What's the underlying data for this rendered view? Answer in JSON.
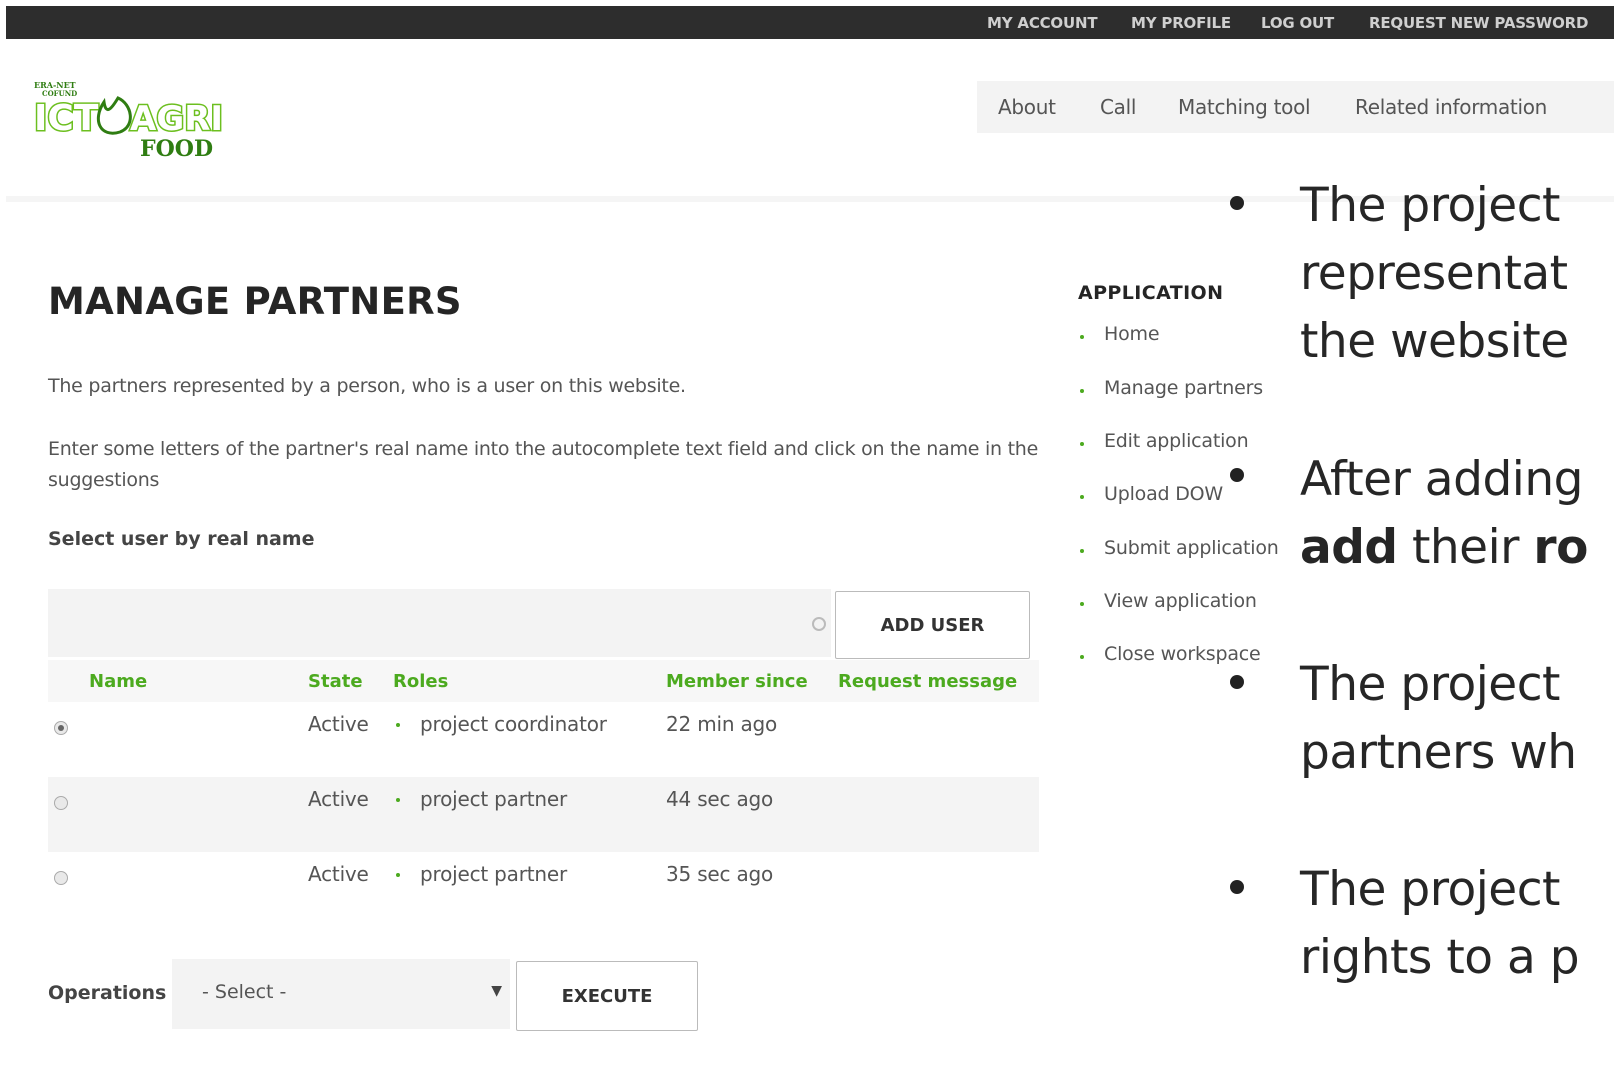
{
  "topbar": {
    "items": [
      "MY ACCOUNT",
      "MY PROFILE",
      "LOG OUT",
      "REQUEST NEW PASSWORD"
    ]
  },
  "logo": {
    "line1": "ERA-NET",
    "line2": "COFUND",
    "main": "ICT AGRI",
    "sub": "FOOD"
  },
  "mainnav": {
    "items": [
      "About",
      "Call",
      "Matching tool",
      "Related information"
    ]
  },
  "page": {
    "title": "MANAGE PARTNERS",
    "intro": "The partners represented by a person, who is a user on this website.",
    "instructions": "Enter some letters of the partner's real name into the autocomplete text field and click on the name in the suggestions",
    "select_label": "Select user by real name",
    "autocomplete_value": "",
    "add_user_label": "ADD USER"
  },
  "table": {
    "headers": {
      "name": "Name",
      "state": "State",
      "roles": "Roles",
      "member_since": "Member since",
      "request_message": "Request message"
    },
    "rows": [
      {
        "selected": true,
        "name": "",
        "state": "Active",
        "role": "project coordinator",
        "member_since": "22 min ago",
        "request_message": ""
      },
      {
        "selected": false,
        "name": "",
        "state": "Active",
        "role": "project partner",
        "member_since": "44 sec ago",
        "request_message": ""
      },
      {
        "selected": false,
        "name": "",
        "state": "Active",
        "role": "project partner",
        "member_since": "35 sec ago",
        "request_message": ""
      }
    ]
  },
  "operations": {
    "label": "Operations",
    "select_value": "- Select -",
    "execute_label": "EXECUTE"
  },
  "sidebar": {
    "title": "APPLICATION",
    "items": [
      "Home",
      "Manage partners",
      "Edit application",
      "Upload DOW",
      "Submit application",
      "View application",
      "Close workspace"
    ]
  },
  "slide": {
    "b1_l1": "The project",
    "b1_l2": "representat",
    "b1_l3": "the website",
    "b2_l1": "After adding",
    "b2_l2_bold1": "add",
    "b2_l2_mid": " their ",
    "b2_l2_bold2": "ro",
    "b3_l1": "The project",
    "b3_l2": "partners wh",
    "b4_l1": "The project",
    "b4_l2": "rights to a p"
  },
  "colors": {
    "topbar_bg": "#2d2d2d",
    "accent_green": "#4caa1f",
    "logo_green": "#6cbf1f",
    "logo_dark_green": "#2f7d12"
  }
}
